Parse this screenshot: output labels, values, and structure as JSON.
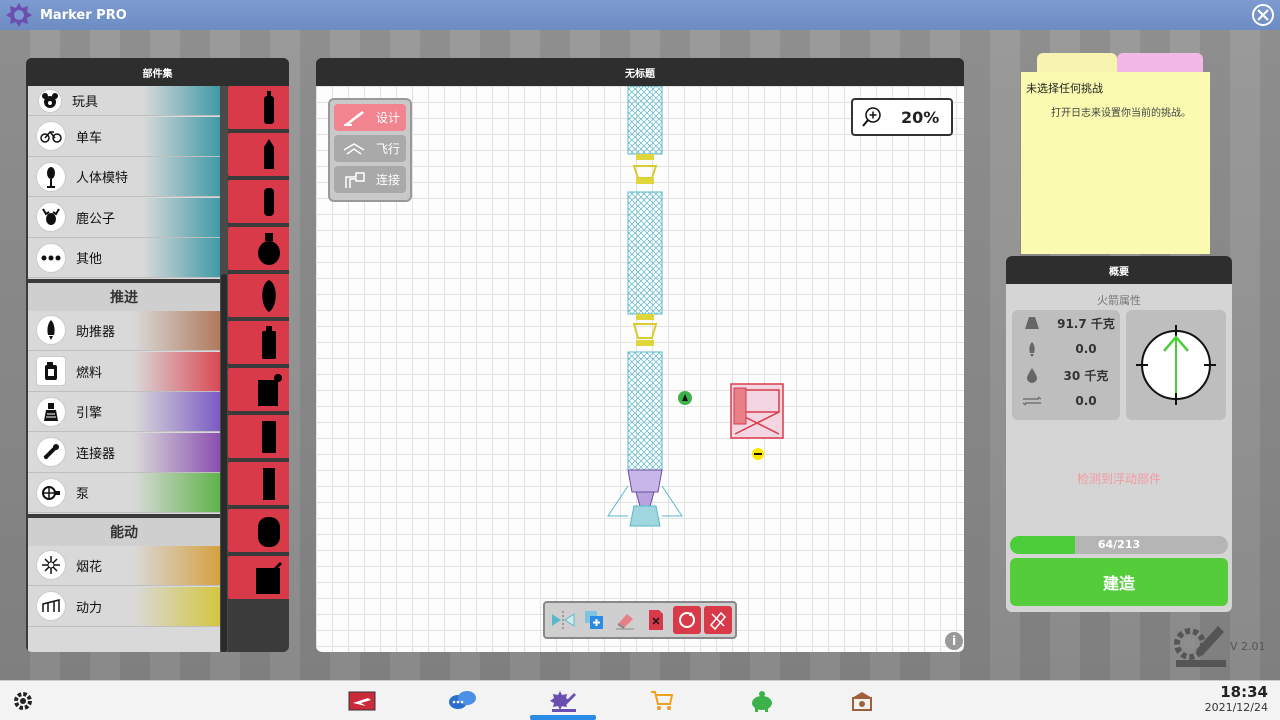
{
  "app": {
    "title": "Marker PRO"
  },
  "parts_panel": {
    "title": "部件集",
    "categories_top": [
      {
        "label": "玩具",
        "icon": "bear-icon"
      },
      {
        "label": "单车",
        "icon": "bicycle-icon"
      },
      {
        "label": "人体模特",
        "icon": "mannequin-icon"
      },
      {
        "label": "鹿公子",
        "icon": "deer-icon"
      },
      {
        "label": "其他",
        "icon": "more-icon"
      }
    ],
    "section_propulsion": "推进",
    "categories_propulsion": [
      {
        "label": "助推器",
        "icon": "booster-icon",
        "color": "#b07a5c"
      },
      {
        "label": "燃料",
        "icon": "fuel-can-icon",
        "color": "#d94a55"
      },
      {
        "label": "引擎",
        "icon": "engine-icon",
        "color": "#7b5bc4"
      },
      {
        "label": "连接器",
        "icon": "connector-icon",
        "color": "#8a4fb0"
      },
      {
        "label": "泵",
        "icon": "pump-icon",
        "color": "#5fb34a"
      }
    ],
    "section_energy": "能动",
    "categories_energy": [
      {
        "label": "烟花",
        "icon": "firework-icon",
        "color": "#d6a040"
      },
      {
        "label": "动力",
        "icon": "power-icon",
        "color": "#d4c640"
      }
    ]
  },
  "canvas": {
    "title": "无标题",
    "modes": [
      {
        "label": "设计",
        "icon": "design-icon",
        "active": true
      },
      {
        "label": "飞行",
        "icon": "flight-icon",
        "active": false
      },
      {
        "label": "连接",
        "icon": "connect-icon",
        "active": false
      }
    ],
    "zoom": "20%"
  },
  "challenge_note": {
    "title": "未选择任何挑战",
    "body": "打开日志来设置你当前的挑战。"
  },
  "summary": {
    "title": "概要",
    "subtitle": "火箭属性",
    "stats": [
      {
        "icon": "weight-icon",
        "value": "91.7 千克"
      },
      {
        "icon": "rocket-icon",
        "value": "0.0"
      },
      {
        "icon": "drop-icon",
        "value": "30 千克"
      },
      {
        "icon": "flow-icon",
        "value": "0.0"
      }
    ],
    "warning": "检测到浮动部件",
    "progress_text": "64/213",
    "progress_fraction": 0.3,
    "build_label": "建造"
  },
  "version": "V 2.01",
  "clock": {
    "time": "18:34",
    "date": "2021/12/24"
  },
  "colors": {
    "accent": "#d93a4a",
    "build": "#55cc3a",
    "nav": "#2a8be6"
  }
}
